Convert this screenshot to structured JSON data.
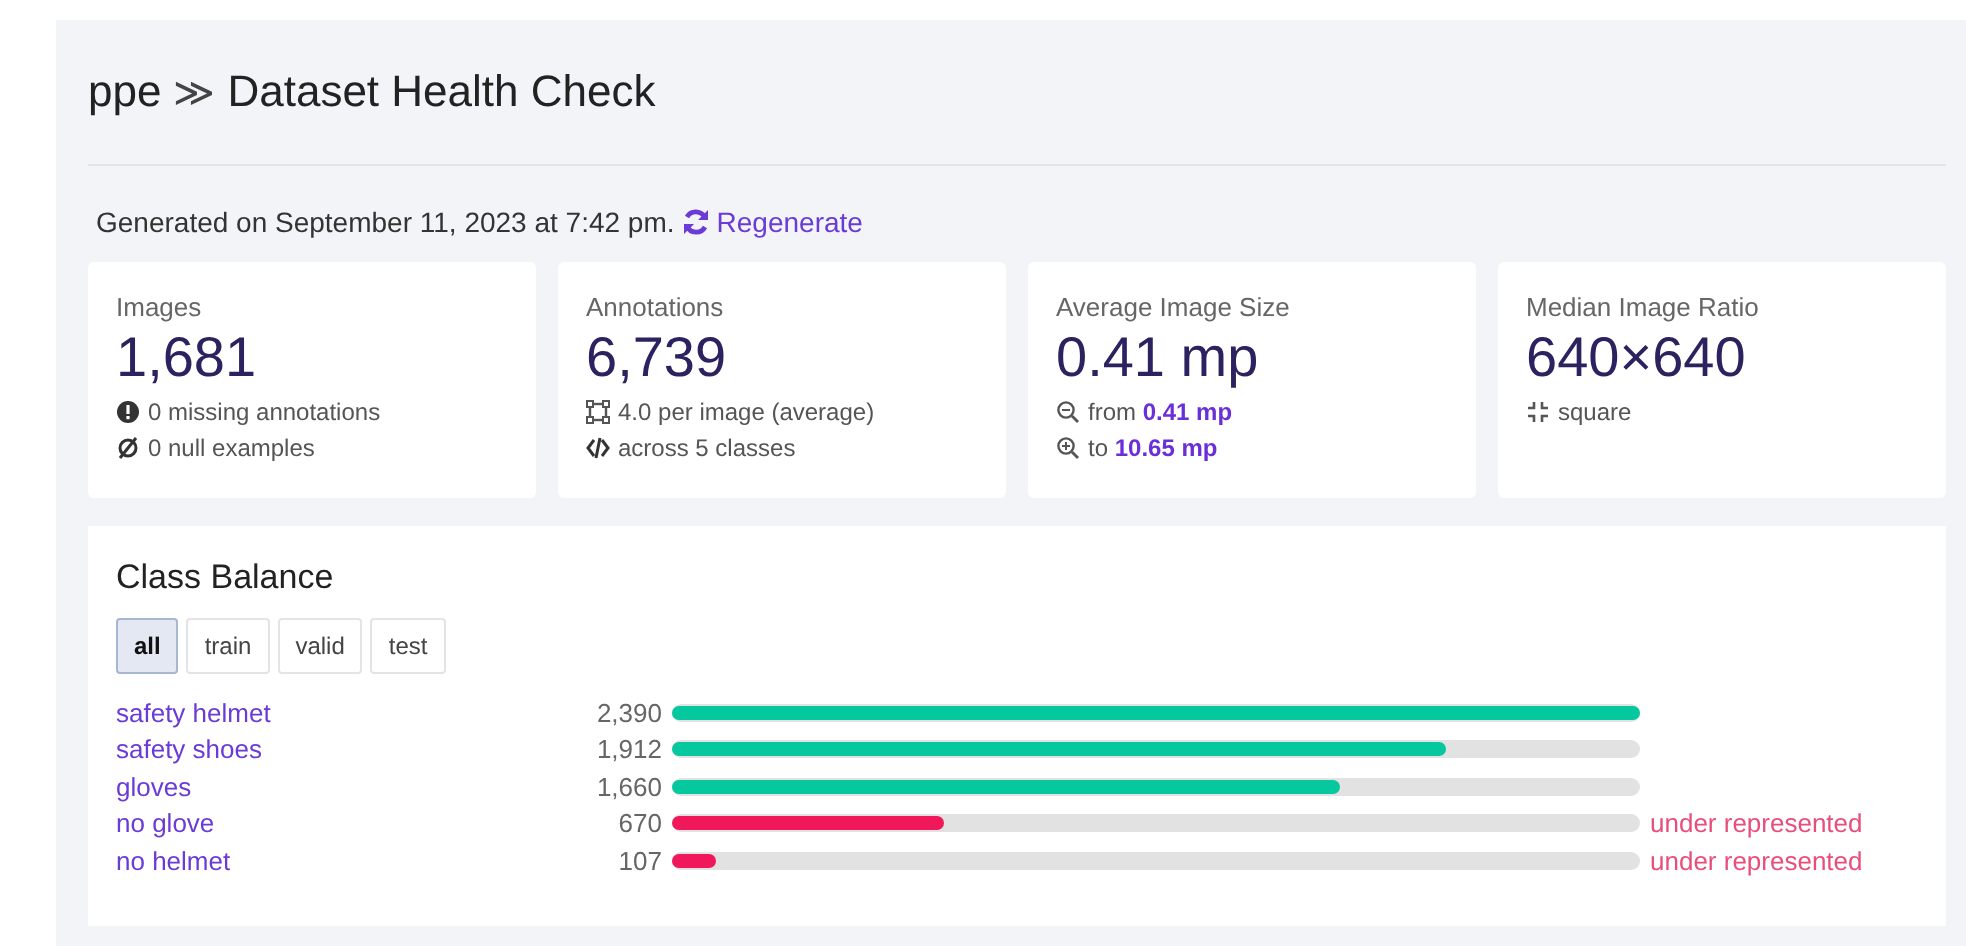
{
  "breadcrumb": {
    "project": "ppe",
    "separator": "≫",
    "page": "Dataset Health Check"
  },
  "generated": {
    "text": "Generated on September 11, 2023 at 7:42 pm.",
    "action": "Regenerate"
  },
  "stats": [
    {
      "label": "Images",
      "value": "1,681",
      "details": [
        {
          "kind": "alert",
          "text": "0 missing annotations"
        },
        {
          "kind": "null",
          "text": "0 null examples"
        }
      ]
    },
    {
      "label": "Annotations",
      "value": "6,739",
      "details": [
        {
          "kind": "box",
          "text": "4.0 per image (average)"
        },
        {
          "kind": "code",
          "text": "across 5 classes"
        }
      ]
    },
    {
      "label": "Average Image Size",
      "value": "0.41 mp",
      "details": [
        {
          "kind": "zoom-out",
          "text": "from **0.41 mp**"
        },
        {
          "kind": "zoom-in",
          "text": "to **10.65 mp**"
        }
      ]
    },
    {
      "label": "Median Image Ratio",
      "value": "640×640",
      "details": [
        {
          "kind": "shrink",
          "text": "square"
        }
      ]
    }
  ],
  "class_balance": {
    "title": "Class Balance",
    "tabs": [
      {
        "label": "all",
        "selected": true
      },
      {
        "label": "train",
        "selected": false
      },
      {
        "label": "valid",
        "selected": false
      },
      {
        "label": "test",
        "selected": false
      }
    ],
    "rows": [
      {
        "name": "safety helmet",
        "count": "2,390",
        "level": 1.0,
        "under_represented": false
      },
      {
        "name": "safety shoes",
        "count": "1,912",
        "level": 0.8,
        "under_represented": false
      },
      {
        "name": "gloves",
        "count": "1,660",
        "level": 0.69,
        "under_represented": false
      },
      {
        "name": "no glove",
        "count": "670",
        "level": 0.28,
        "under_represented": true,
        "note": "under represented"
      },
      {
        "name": "no helmet",
        "count": "107",
        "level": 0.045,
        "under_represented": true,
        "note": "under represented"
      }
    ]
  }
}
